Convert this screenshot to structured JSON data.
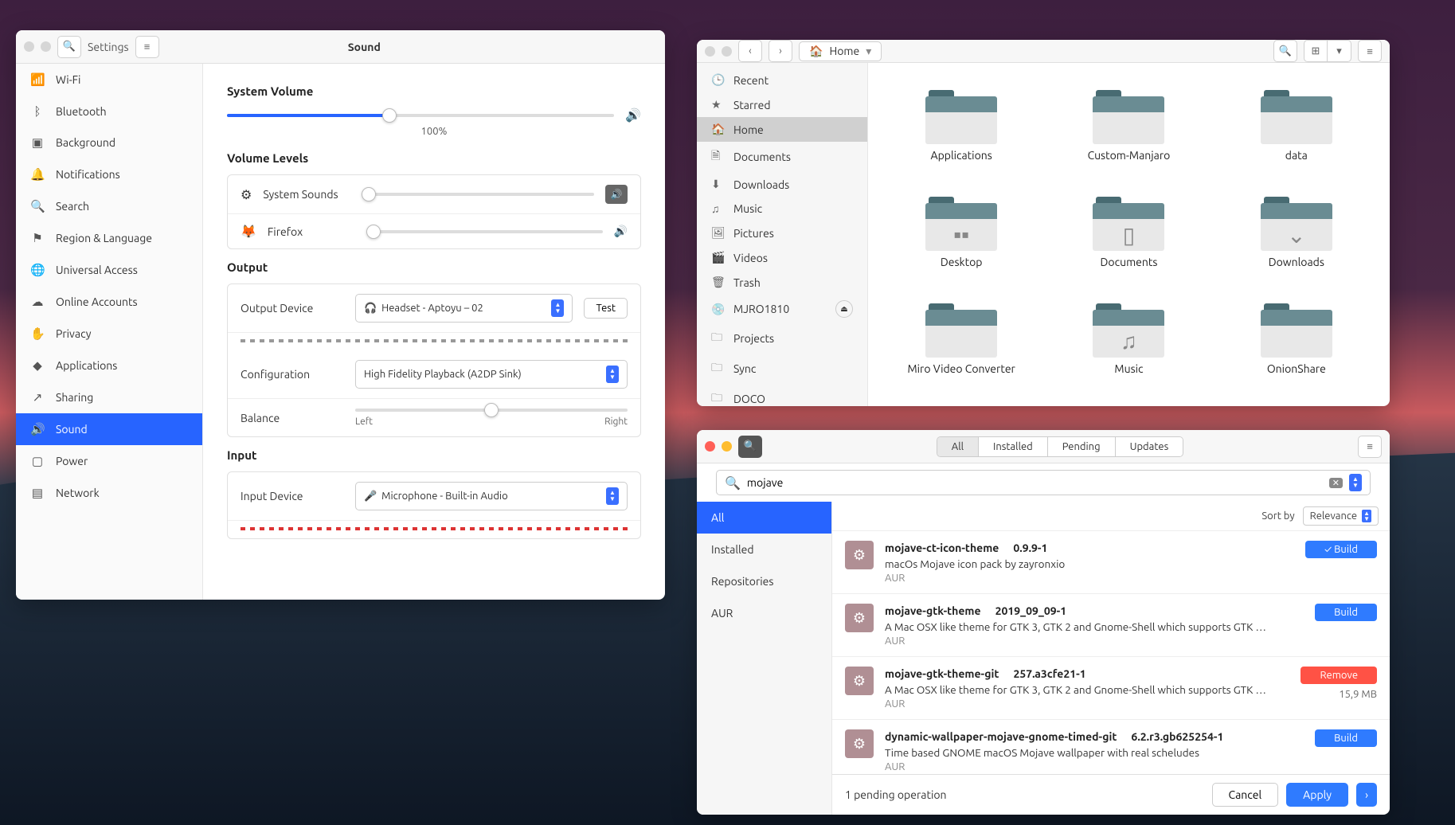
{
  "settings": {
    "app_label": "Settings",
    "title": "Sound",
    "sidebar": [
      {
        "icon": "📶",
        "label": "Wi-Fi"
      },
      {
        "icon": "ᛒ",
        "label": "Bluetooth"
      },
      {
        "icon": "▣",
        "label": "Background"
      },
      {
        "icon": "🔔",
        "label": "Notifications"
      },
      {
        "icon": "🔍",
        "label": "Search"
      },
      {
        "icon": "⚑",
        "label": "Region & Language"
      },
      {
        "icon": "🌐",
        "label": "Universal Access"
      },
      {
        "icon": "☁",
        "label": "Online Accounts"
      },
      {
        "icon": "✋",
        "label": "Privacy"
      },
      {
        "icon": "◆",
        "label": "Applications"
      },
      {
        "icon": "↗",
        "label": "Sharing"
      },
      {
        "icon": "🔊",
        "label": "Sound",
        "active": true
      },
      {
        "icon": "▢",
        "label": "Power"
      },
      {
        "icon": "▤",
        "label": "Network"
      }
    ],
    "system_volume": {
      "heading": "System Volume",
      "percent_label": "100%",
      "value": 42
    },
    "volume_levels": {
      "heading": "Volume Levels",
      "rows": [
        {
          "icon": "⚙",
          "label": "System Sounds",
          "value": 3,
          "muted_style": true
        },
        {
          "icon": "🦊",
          "label": "Firefox",
          "value": 3
        }
      ]
    },
    "output": {
      "heading": "Output",
      "device_label": "Output Device",
      "device_value": "Headset - Aptoyu  –  02",
      "device_icon": "🎧",
      "test_label": "Test",
      "config_label": "Configuration",
      "config_value": "High Fidelity Playback (A2DP Sink)",
      "balance_label": "Balance",
      "balance_left": "Left",
      "balance_right": "Right"
    },
    "input": {
      "heading": "Input",
      "device_label": "Input Device",
      "device_icon": "🎤",
      "device_value": "Microphone - Built-in Audio"
    }
  },
  "files": {
    "crumb": "Home",
    "sidebar": [
      {
        "icon": "🕒",
        "label": "Recent"
      },
      {
        "icon": "★",
        "label": "Starred"
      },
      {
        "icon": "🏠",
        "label": "Home",
        "active": true
      },
      {
        "icon": "🗎",
        "label": "Documents"
      },
      {
        "icon": "⬇",
        "label": "Downloads"
      },
      {
        "icon": "♫",
        "label": "Music"
      },
      {
        "icon": "🖼",
        "label": "Pictures"
      },
      {
        "icon": "🎬",
        "label": "Videos"
      },
      {
        "icon": "🗑",
        "label": "Trash"
      },
      {
        "icon": "💿",
        "label": "MJRO1810",
        "eject": true
      },
      {
        "icon": "🗀",
        "label": "Projects"
      },
      {
        "icon": "🗀",
        "label": "Sync"
      },
      {
        "icon": "🗀",
        "label": "DOCO"
      }
    ],
    "folders": [
      {
        "label": "Applications",
        "glyph": ""
      },
      {
        "label": "Custom-Manjaro",
        "glyph": ""
      },
      {
        "label": "data",
        "glyph": ""
      },
      {
        "label": "Desktop",
        "glyph": "▪▪"
      },
      {
        "label": "Documents",
        "glyph": "▯"
      },
      {
        "label": "Downloads",
        "glyph": "⌄"
      },
      {
        "label": "Miro Video Converter",
        "glyph": ""
      },
      {
        "label": "Music",
        "glyph": "♫"
      },
      {
        "label": "OnionShare",
        "glyph": ""
      }
    ]
  },
  "pkg": {
    "tabs": [
      "All",
      "Installed",
      "Pending",
      "Updates"
    ],
    "active_tab": 0,
    "search_value": "mojave",
    "filters": [
      "All",
      "Installed",
      "Repositories",
      "AUR"
    ],
    "active_filter": 0,
    "sort_label": "Sort by",
    "sort_value": "Relevance",
    "results": [
      {
        "name": "mojave-ct-icon-theme",
        "version": "0.9.9-1",
        "desc": "macOs Mojave icon pack by zayronxio",
        "source": "AUR",
        "action": "Build",
        "installed": true
      },
      {
        "name": "mojave-gtk-theme",
        "version": "2019_09_09-1",
        "desc": "A Mac OSX like theme for GTK 3, GTK 2 and Gnome-Shell which supports GTK …",
        "source": "AUR",
        "action": "Build"
      },
      {
        "name": "mojave-gtk-theme-git",
        "version": "257.a3cfe21-1",
        "desc": "A Mac OSX like theme for GTK 3, GTK 2 and Gnome-Shell which supports GTK …",
        "source": "AUR",
        "action": "Remove",
        "size": "15,9 MB"
      },
      {
        "name": "dynamic-wallpaper-mojave-gnome-timed-git",
        "version": "6.2.r3.gb625254-1",
        "desc": "Time based GNOME macOS Mojave wallpaper with real scheludes",
        "source": "AUR",
        "action": "Build"
      }
    ],
    "pending_text": "1 pending operation",
    "cancel": "Cancel",
    "apply": "Apply"
  }
}
